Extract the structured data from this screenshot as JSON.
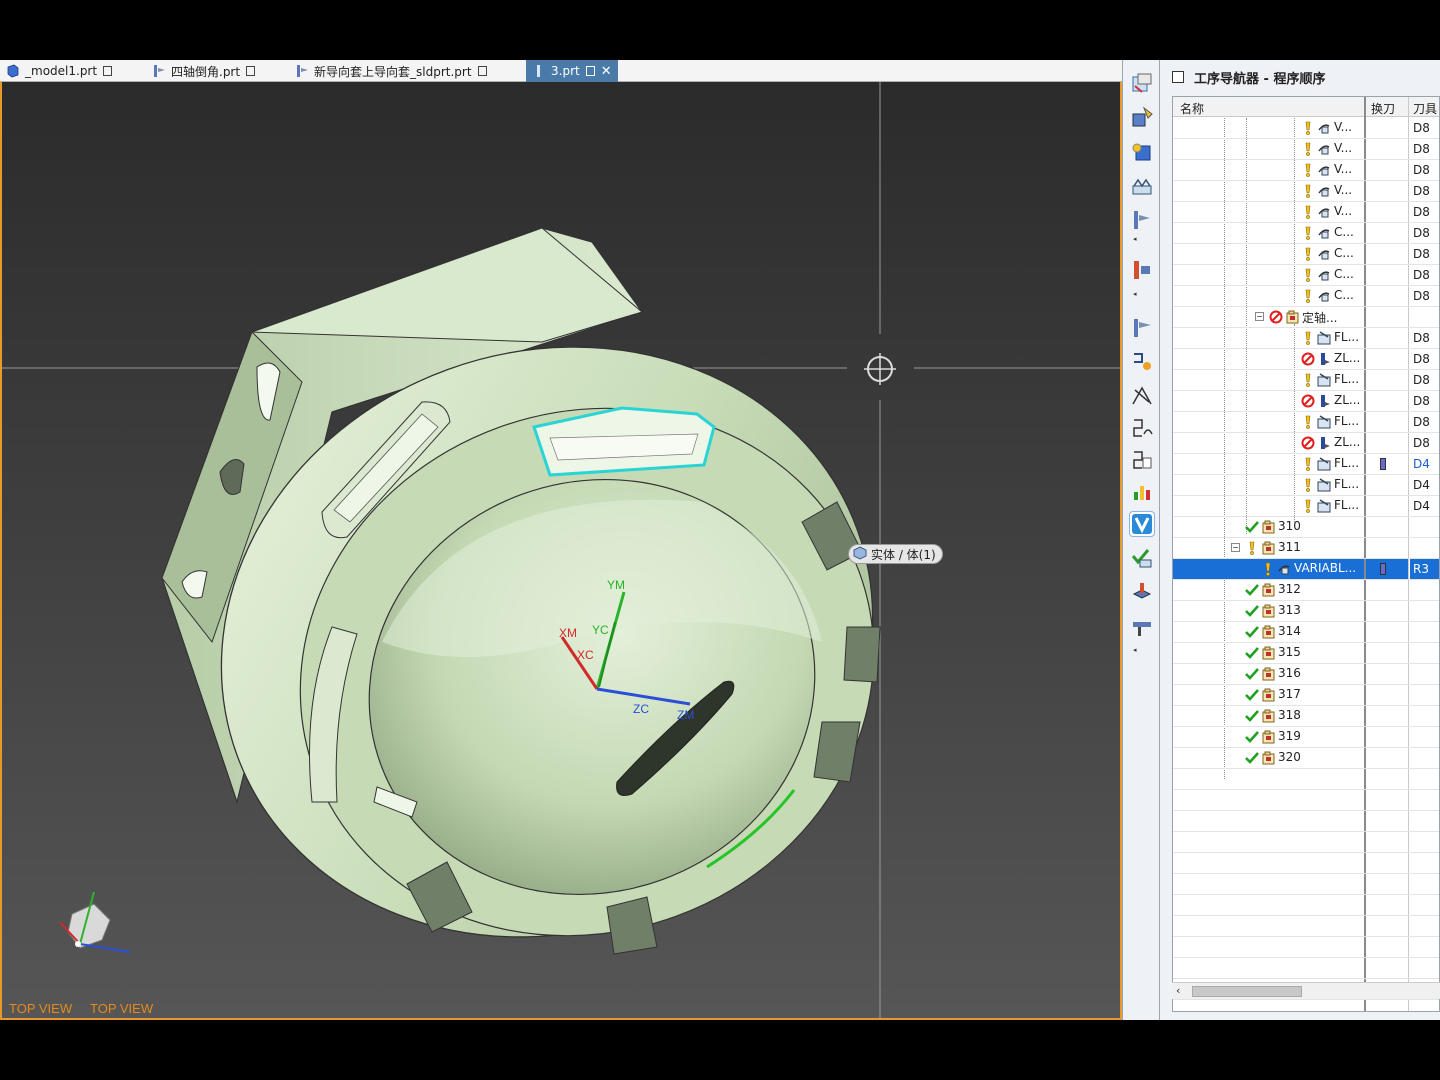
{
  "tabs": [
    {
      "label": "_model1.prt",
      "active": false
    },
    {
      "label": "四轴倒角.prt",
      "active": false
    },
    {
      "label": "新导向套上导向套_sldprt.prt",
      "active": false
    },
    {
      "label": "3.prt",
      "active": true
    }
  ],
  "viewport": {
    "view_labels": [
      "TOP VIEW",
      "TOP VIEW"
    ],
    "tooltip": "实体 / 体(1)",
    "axis_labels": [
      "YM",
      "YC",
      "XM",
      "XC",
      "ZC",
      "ZM"
    ],
    "colors": {
      "border": "#e79a2a",
      "part": "#cfe3c2",
      "highlight": "#2ad4d4",
      "edge_green": "#27c427"
    }
  },
  "resource_bar": {
    "buttons": [
      "operation-navigator-icon",
      "machine-tool-navigator-icon",
      "part-navigator-icon",
      "history-icon",
      "tool-path-icon",
      "assembly-icon",
      "feature-icon",
      "cut-icon",
      "spline-icon",
      "sheet-icon",
      "analysis-icon",
      "visualization-icon",
      "check-icon",
      "simulation-icon",
      "roles-icon"
    ]
  },
  "navigator": {
    "title": "工序导航器 - 程序顺序",
    "columns": [
      "名称",
      "换刀",
      "刀具"
    ],
    "rows": [
      {
        "status": "pending",
        "type": "op",
        "name": "V...",
        "tool": "D8"
      },
      {
        "status": "pending",
        "type": "op",
        "name": "V...",
        "tool": "D8"
      },
      {
        "status": "pending",
        "type": "op",
        "name": "V...",
        "tool": "D8"
      },
      {
        "status": "pending",
        "type": "op",
        "name": "V...",
        "tool": "D8"
      },
      {
        "status": "pending",
        "type": "op",
        "name": "V...",
        "tool": "D8"
      },
      {
        "status": "pending",
        "type": "op",
        "name": "C...",
        "tool": "D8"
      },
      {
        "status": "pending",
        "type": "op",
        "name": "C...",
        "tool": "D8"
      },
      {
        "status": "pending",
        "type": "op",
        "name": "C...",
        "tool": "D8"
      },
      {
        "status": "pending",
        "type": "op",
        "name": "C...",
        "tool": "D8"
      },
      {
        "status": "blocked",
        "type": "group",
        "name": "定轴...",
        "tool": ""
      },
      {
        "status": "pending",
        "type": "op2",
        "name": "FL...",
        "tool": "D8"
      },
      {
        "status": "blocked",
        "type": "op3",
        "name": "ZL...",
        "tool": "D8"
      },
      {
        "status": "pending",
        "type": "op2",
        "name": "FL...",
        "tool": "D8"
      },
      {
        "status": "blocked",
        "type": "op3",
        "name": "ZL...",
        "tool": "D8"
      },
      {
        "status": "pending",
        "type": "op2",
        "name": "FL...",
        "tool": "D8"
      },
      {
        "status": "blocked",
        "type": "op3",
        "name": "ZL...",
        "tool": "D8"
      },
      {
        "status": "pending",
        "type": "op2",
        "name": "FL...",
        "tool": "D4",
        "tool_change": true
      },
      {
        "status": "pending",
        "type": "op2",
        "name": "FL...",
        "tool": "D4"
      },
      {
        "status": "pending",
        "type": "op2",
        "name": "FL...",
        "tool": "D4"
      },
      {
        "status": "complete",
        "type": "group",
        "name": "310",
        "tool": ""
      },
      {
        "status": "pending",
        "type": "group",
        "name": "311",
        "tool": ""
      },
      {
        "status": "pending",
        "type": "op",
        "name": "VARIABL...",
        "tool": "R3",
        "tool_change": true,
        "selected": true
      },
      {
        "status": "complete",
        "type": "group",
        "name": "312",
        "tool": ""
      },
      {
        "status": "complete",
        "type": "group",
        "name": "313",
        "tool": ""
      },
      {
        "status": "complete",
        "type": "group",
        "name": "314",
        "tool": ""
      },
      {
        "status": "complete",
        "type": "group",
        "name": "315",
        "tool": ""
      },
      {
        "status": "complete",
        "type": "group",
        "name": "316",
        "tool": ""
      },
      {
        "status": "complete",
        "type": "group",
        "name": "317",
        "tool": ""
      },
      {
        "status": "complete",
        "type": "group",
        "name": "318",
        "tool": ""
      },
      {
        "status": "complete",
        "type": "group",
        "name": "319",
        "tool": ""
      },
      {
        "status": "complete",
        "type": "group",
        "name": "320",
        "tool": ""
      }
    ]
  }
}
